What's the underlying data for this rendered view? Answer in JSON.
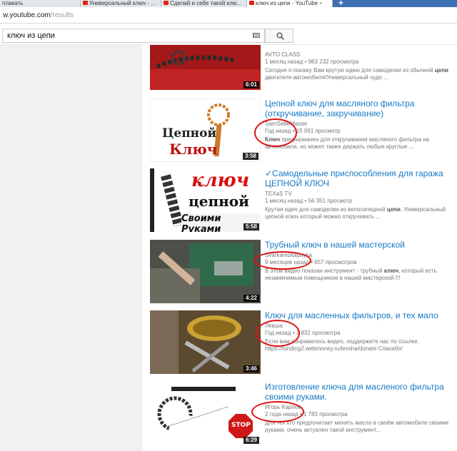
{
  "browser": {
    "tabs": [
      {
        "label": "плакать",
        "active": false
      },
      {
        "label": "Универсальный ключ - ...",
        "active": false
      },
      {
        "label": "Сделай и себе такой клю...",
        "active": false
      },
      {
        "label": "ключ из цепи - YouTube",
        "active": true
      }
    ],
    "new_tab": "+",
    "close": "×",
    "url_host": "w.youtube.com",
    "url_path": "/results"
  },
  "search": {
    "query": "ключ из цепи",
    "keyboard_icon": "keyboard-icon",
    "search_icon": "search-icon"
  },
  "results": [
    {
      "title": "",
      "channel": "AVTO CLASS",
      "stats": "1 месяц назад  •  983 232 просмотра",
      "desc_pre": "Сегодня я покажу Вам крутую идею для самоделки из обычной ",
      "desc_bold": "цепи",
      "desc_post": " двигателя автомобиля/Универсальный чудо ...",
      "duration": "6:01"
    },
    {
      "title": "Цепной ключ для масляного фильтра (откручивание, закручивание)",
      "channel": "SamSebeMaster",
      "stats": "Год назад  •  15 061 просмотр",
      "desc_bold": "Ключ",
      "desc_post": " предназначен для откручивания масляного фильтра на автомобиле, но может также держать любые круглые ...",
      "duration": "3:58",
      "thumb_text_1": "Цепной",
      "thumb_text_2": "Ключ"
    },
    {
      "title": "✓Самодельные приспособления для гаража ЦЕПНОЙ КЛЮЧ",
      "channel": "TEXaS TV",
      "stats": "1 месяц назад  •  56 351 просмотр",
      "desc_pre": "Крутая идея для самоделки из велосипедной ",
      "desc_bold": "цепи",
      "desc_post": ". Универсальный цепной ключ который можно откручивать ...",
      "duration": "5:58",
      "thumb_text_1": "ключ",
      "thumb_text_2": "цепной",
      "thumb_text_3": "Своими Руками"
    },
    {
      "title": "Трубный ключ в нашей мастерской",
      "channel": "Svarkarezkapayka",
      "stats": "9 месяцев назад  •  657 просмотров",
      "desc_pre": "В этом видео показан инструмент - трубный ",
      "desc_bold": "ключ",
      "desc_post": ", который есть незаменимым помощником в нашей мастерской !!!",
      "duration": "4:22"
    },
    {
      "title": "Ключ для масленных фильтров, и тех мало",
      "channel": "Левша",
      "stats": "Год назад  •  3 832 просмотра",
      "desc_pre": "Если вам понравилось видео, поддержите нас по ссылке. https://funding2.webmoney.ru/levsha/donate Спасибо!",
      "duration": "3:46"
    },
    {
      "title": "Изготовление ключа для масленого фильтра своими руками.",
      "channel": "Игорь Карпов",
      "stats": "2 года назад  •  1 783 просмотра",
      "desc_pre": "Для тех кто предпочитает менять масло в своём автомобиле своими руками, очень актуален такой инструмент...",
      "duration": "6:29",
      "thumb_text_1": "STOP"
    }
  ],
  "colors": {
    "link": "#167ac6",
    "annotation": "#e01010",
    "youtube_red": "#e62117"
  }
}
